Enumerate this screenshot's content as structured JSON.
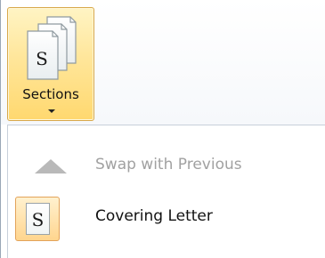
{
  "ribbon": {
    "sections_button": {
      "label": "Sections",
      "icon": "stacked-documents-s-icon",
      "icon_letter": "S"
    }
  },
  "menu": {
    "items": [
      {
        "label": "Swap with Previous",
        "icon": "up-triangle-icon",
        "enabled": false
      },
      {
        "label": "Covering Letter",
        "icon": "section-document-icon",
        "icon_letter": "S",
        "enabled": true
      }
    ]
  },
  "colors": {
    "button_highlight": "#ffe69a",
    "button_border": "#d8a84a",
    "disabled_text": "#a1a1a1"
  }
}
